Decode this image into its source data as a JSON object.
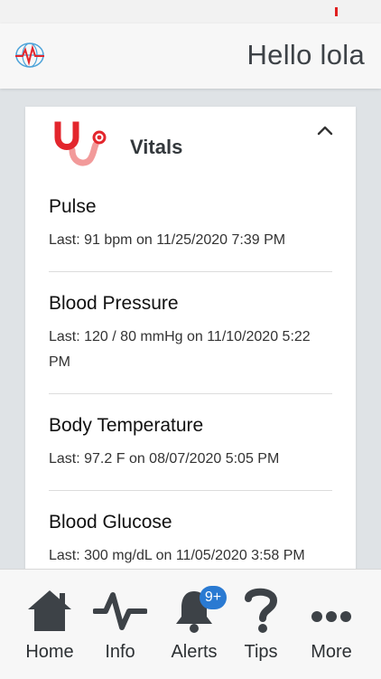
{
  "header": {
    "greeting": "Hello lola"
  },
  "card": {
    "title": "Vitals",
    "items": [
      {
        "name": "Pulse",
        "last": "Last: 91 bpm on 11/25/2020 7:39 PM"
      },
      {
        "name": "Blood Pressure",
        "last": "Last: 120 / 80 mmHg on 11/10/2020 5:22 PM"
      },
      {
        "name": "Body Temperature",
        "last": "Last: 97.2 F on 08/07/2020 5:05 PM"
      },
      {
        "name": "Blood Glucose",
        "last": "Last: 300 mg/dL on 11/05/2020 3:58 PM"
      }
    ]
  },
  "tabs": [
    {
      "label": "Home",
      "icon": "home-icon"
    },
    {
      "label": "Info",
      "icon": "pulse-icon"
    },
    {
      "label": "Alerts",
      "icon": "bell-icon",
      "badge": "9+"
    },
    {
      "label": "Tips",
      "icon": "question-icon"
    },
    {
      "label": "More",
      "icon": "more-icon"
    }
  ],
  "colors": {
    "accent_red": "#e3262d",
    "accent_pink": "#f29a9a",
    "badge_blue": "#2a7ad2",
    "icon_dark": "#3d4247"
  }
}
